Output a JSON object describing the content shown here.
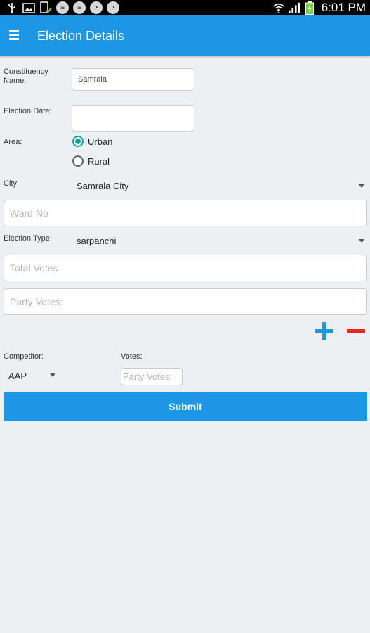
{
  "status_bar": {
    "time": "6:01 PM",
    "icons": [
      "usb-icon",
      "image-icon",
      "clipboard-check-icon",
      "notification-icon",
      "notification-icon",
      "notification-icon",
      "notification-icon",
      "wifi-icon",
      "signal-icon",
      "battery-charging-icon"
    ]
  },
  "appbar": {
    "title": "Election Details",
    "menu_icon": "hamburger-icon"
  },
  "form": {
    "constituency": {
      "label_line1": "Constituency",
      "label_line2": "Name:",
      "value": "Samrala"
    },
    "election_date": {
      "label": "Election Date:",
      "value": ""
    },
    "area": {
      "label": "Area:",
      "options": [
        "Urban",
        "Rural"
      ],
      "selected": "Urban"
    },
    "city": {
      "label": "City",
      "value": "Samrala City"
    },
    "ward": {
      "placeholder": "Ward No"
    },
    "election_type": {
      "label": "Election Type:",
      "value": "sarpanchi"
    },
    "total_votes": {
      "placeholder": "Total Votes"
    },
    "party_votes": {
      "placeholder": "Party Votes:"
    },
    "competitor": {
      "label": "Competitor:",
      "value": "AAP"
    },
    "votes": {
      "label": "Votes:",
      "placeholder": "Party Votes:"
    },
    "submit_label": "Submit"
  },
  "colors": {
    "primary": "#1e96e6",
    "radio_accent": "#10a39a",
    "minus_red": "#e8241d",
    "background": "#edf0f2"
  }
}
